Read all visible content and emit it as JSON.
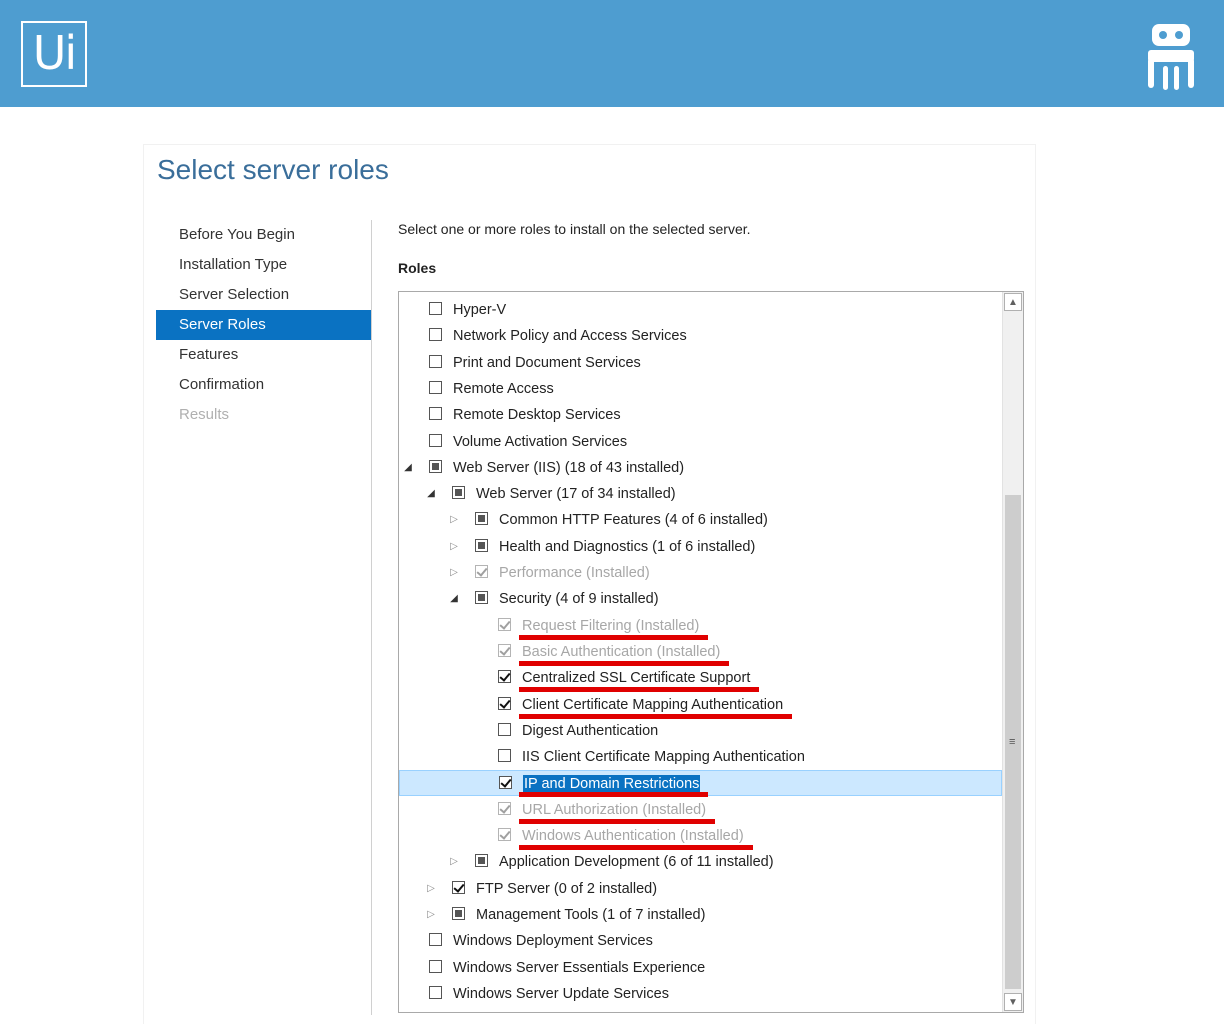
{
  "header": {
    "logo_text": "Ui",
    "robot_icon": "robot-icon",
    "background_color": "#4e9dd0"
  },
  "dialog": {
    "title": "Select server roles",
    "instruction": "Select one or more roles to install on the selected server.",
    "roles_label": "Roles",
    "nav": [
      {
        "label": "Before You Begin",
        "state": "normal"
      },
      {
        "label": "Installation Type",
        "state": "normal"
      },
      {
        "label": "Server Selection",
        "state": "normal"
      },
      {
        "label": "Server Roles",
        "state": "active"
      },
      {
        "label": "Features",
        "state": "normal"
      },
      {
        "label": "Confirmation",
        "state": "normal"
      },
      {
        "label": "Results",
        "state": "disabled"
      }
    ],
    "roles": [
      {
        "label": "Hyper-V",
        "level": 0,
        "expander": "none",
        "check": "unchecked"
      },
      {
        "label": "Network Policy and Access Services",
        "level": 0,
        "expander": "none",
        "check": "unchecked"
      },
      {
        "label": "Print and Document Services",
        "level": 0,
        "expander": "none",
        "check": "unchecked"
      },
      {
        "label": "Remote Access",
        "level": 0,
        "expander": "none",
        "check": "unchecked"
      },
      {
        "label": "Remote Desktop Services",
        "level": 0,
        "expander": "none",
        "check": "unchecked"
      },
      {
        "label": "Volume Activation Services",
        "level": 0,
        "expander": "none",
        "check": "unchecked"
      },
      {
        "label": "Web Server (IIS) (18 of 43 installed)",
        "level": 0,
        "expander": "open",
        "check": "partial"
      },
      {
        "label": "Web Server (17 of 34 installed)",
        "level": 1,
        "expander": "open",
        "check": "partial"
      },
      {
        "label": "Common HTTP Features (4 of 6 installed)",
        "level": 2,
        "expander": "closed",
        "check": "partial"
      },
      {
        "label": "Health and Diagnostics (1 of 6 installed)",
        "level": 2,
        "expander": "closed",
        "check": "partial"
      },
      {
        "label": "Performance (Installed)",
        "level": 2,
        "expander": "closed",
        "check": "installed"
      },
      {
        "label": "Security (4 of 9 installed)",
        "level": 2,
        "expander": "open",
        "check": "partial"
      },
      {
        "label": "Request Filtering (Installed)",
        "level": 3,
        "expander": "none",
        "check": "installed",
        "marked": true
      },
      {
        "label": "Basic Authentication (Installed)",
        "level": 3,
        "expander": "none",
        "check": "installed",
        "marked": true
      },
      {
        "label": "Centralized SSL Certificate Support",
        "level": 3,
        "expander": "none",
        "check": "checked",
        "marked": true
      },
      {
        "label": "Client Certificate Mapping Authentication",
        "level": 3,
        "expander": "none",
        "check": "checked",
        "marked": true
      },
      {
        "label": "Digest Authentication",
        "level": 3,
        "expander": "none",
        "check": "unchecked"
      },
      {
        "label": "IIS Client Certificate Mapping Authentication",
        "level": 3,
        "expander": "none",
        "check": "unchecked"
      },
      {
        "label": "IP and Domain Restrictions",
        "level": 3,
        "expander": "none",
        "check": "checked",
        "marked": true,
        "selected": true
      },
      {
        "label": "URL Authorization (Installed)",
        "level": 3,
        "expander": "none",
        "check": "installed",
        "marked": true
      },
      {
        "label": "Windows Authentication (Installed)",
        "level": 3,
        "expander": "none",
        "check": "installed",
        "marked": true
      },
      {
        "label": "Application Development (6 of 11 installed)",
        "level": 2,
        "expander": "closed",
        "check": "partial"
      },
      {
        "label": "FTP Server (0 of 2 installed)",
        "level": 1,
        "expander": "closed",
        "check": "checked"
      },
      {
        "label": "Management Tools (1 of 7 installed)",
        "level": 1,
        "expander": "closed",
        "check": "partial"
      },
      {
        "label": "Windows Deployment Services",
        "level": 0,
        "expander": "none",
        "check": "unchecked"
      },
      {
        "label": "Windows Server Essentials Experience",
        "level": 0,
        "expander": "none",
        "check": "unchecked"
      },
      {
        "label": "Windows Server Update Services",
        "level": 0,
        "expander": "none",
        "check": "unchecked"
      }
    ],
    "annotation_color": "#e00000",
    "selection_color": "#0a72c2"
  }
}
